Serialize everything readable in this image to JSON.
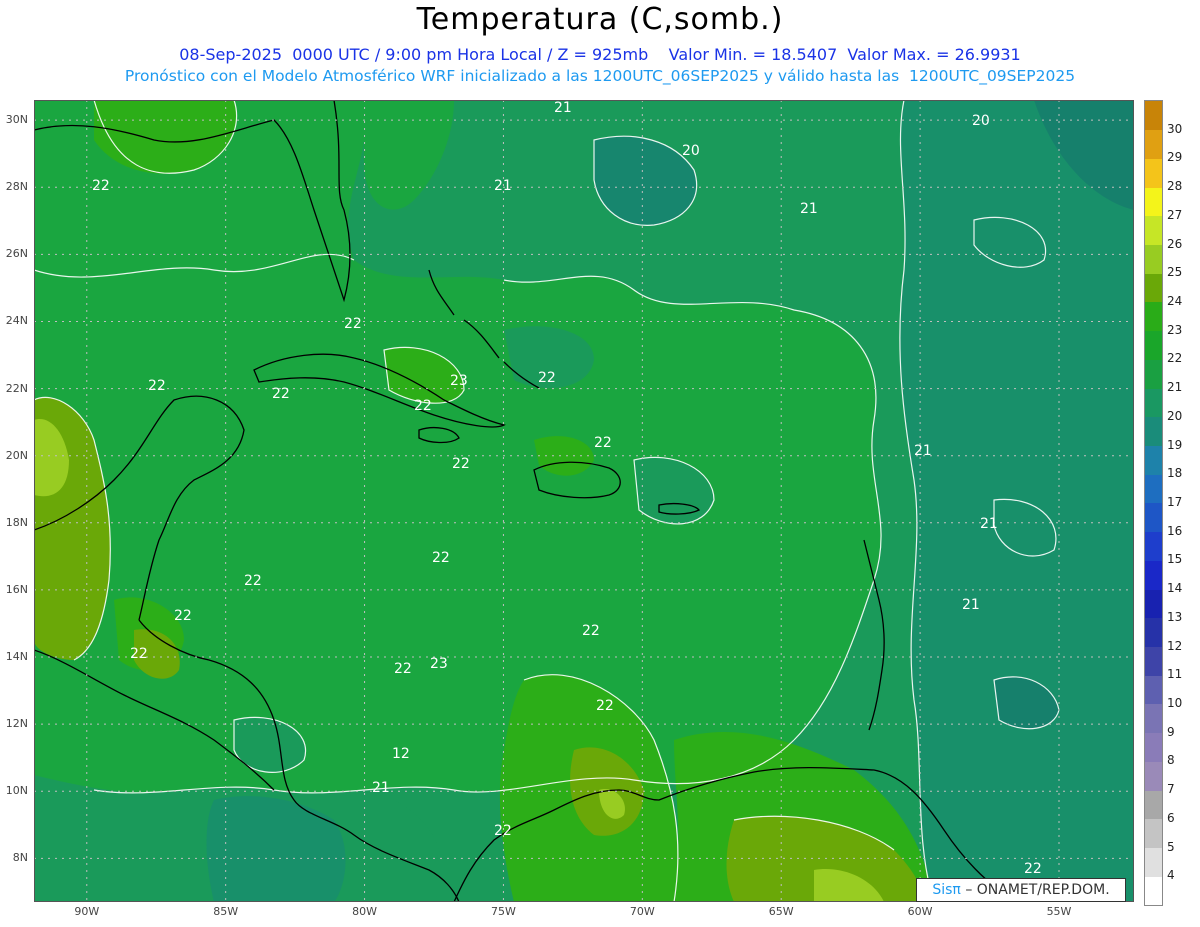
{
  "header": {
    "title": "Temperatura (C,somb.)",
    "line1": "08-Sep-2025  0000 UTC / 9:00 pm Hora Local / Z = 925mb    Valor Min. = 18.5407  Valor Max. = 26.9931",
    "line2": "Pronóstico con el Modelo Atmosférico WRF inicializado a las 1200UTC_06SEP2025 y válido hasta las  1200UTC_09SEP2025"
  },
  "credit": {
    "brand": "Sisπ",
    "org": "– ONAMET/REP.DOM."
  },
  "axes": {
    "lat_labels": [
      "30N",
      "28N",
      "26N",
      "24N",
      "22N",
      "20N",
      "18N",
      "16N",
      "14N",
      "12N",
      "10N",
      "8N"
    ],
    "lon_labels": [
      "90W",
      "85W",
      "80W",
      "75W",
      "70W",
      "65W",
      "60W",
      "55W"
    ],
    "lat_range": [
      6.7,
      30.6
    ],
    "lon_range": [
      91.9,
      52.3
    ]
  },
  "colorbar": {
    "labels": [
      "4",
      "5",
      "6",
      "7",
      "8",
      "9",
      "10",
      "11",
      "12",
      "13",
      "14",
      "15",
      "16",
      "17",
      "18",
      "19",
      "20",
      "21",
      "22",
      "23",
      "24",
      "25",
      "26",
      "27",
      "28",
      "29",
      "30"
    ],
    "colors": [
      "#ffffff",
      "#e0e0e0",
      "#c4c4c4",
      "#a8a8a8",
      "#9a8ab8",
      "#8a7cb8",
      "#7a74b4",
      "#5e60b0",
      "#3e44a8",
      "#2632a8",
      "#1822b0",
      "#1a28c8",
      "#1e3ecc",
      "#1e56c6",
      "#1e6ec0",
      "#1e82aa",
      "#1a8c7a",
      "#1a9862",
      "#1aa042",
      "#1aa62a",
      "#2aac18",
      "#6aa808",
      "#98cc22",
      "#c6e626",
      "#f4f41a",
      "#f4c41a",
      "#e0a012",
      "#c88408"
    ]
  },
  "contour_labels": [
    {
      "text": "21"
    },
    {
      "text": "20"
    },
    {
      "text": "20"
    },
    {
      "text": "22"
    },
    {
      "text": "21"
    },
    {
      "text": "21"
    },
    {
      "text": "22"
    },
    {
      "text": "22"
    },
    {
      "text": "22"
    },
    {
      "text": "23"
    },
    {
      "text": "22"
    },
    {
      "text": "22"
    },
    {
      "text": "22"
    },
    {
      "text": "22"
    },
    {
      "text": "21"
    },
    {
      "text": "21"
    },
    {
      "text": "22"
    },
    {
      "text": "21"
    },
    {
      "text": "22"
    },
    {
      "text": "22"
    },
    {
      "text": "22"
    },
    {
      "text": "23"
    },
    {
      "text": "22"
    },
    {
      "text": "22"
    },
    {
      "text": "12"
    },
    {
      "text": "22"
    },
    {
      "text": "21"
    },
    {
      "text": "22"
    },
    {
      "text": "22"
    }
  ]
}
